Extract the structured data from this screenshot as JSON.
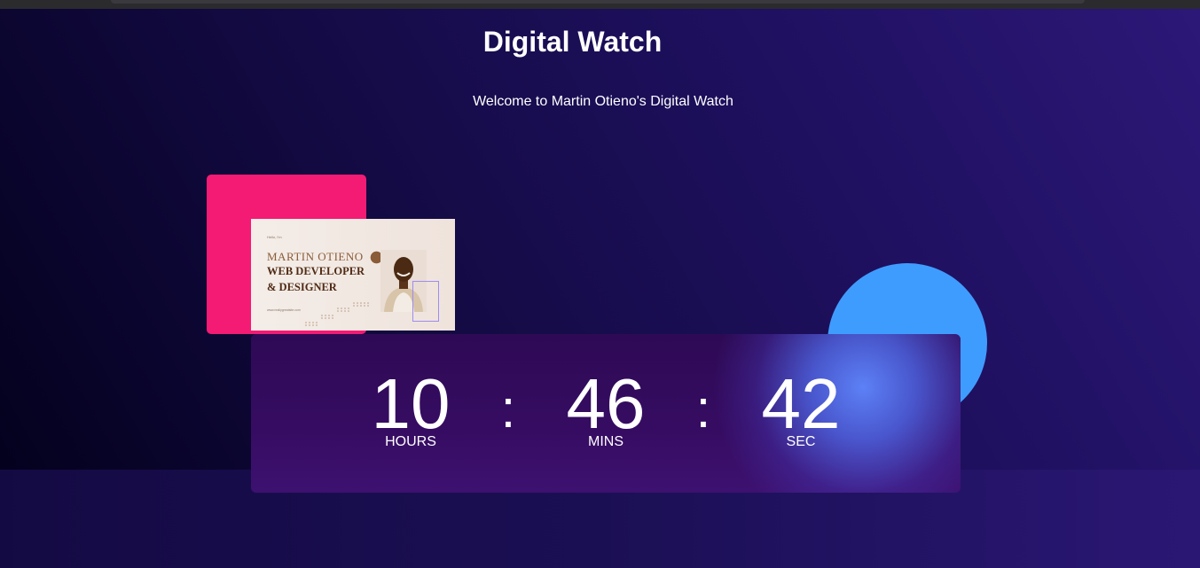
{
  "page": {
    "title": "Digital Watch",
    "subtitle": "Welcome to Martin Otieno's Digital Watch"
  },
  "banner": {
    "small_text": "Hello, I'm",
    "name": "MARTIN OTIENO",
    "role_line1": "WEB DEVELOPER",
    "role_line2": "& DESIGNER",
    "url": "www.reallygreatsite.com"
  },
  "clock": {
    "hours": "10",
    "minutes": "46",
    "seconds": "42",
    "separator": ":",
    "hours_label": "HOURS",
    "minutes_label": "MINS",
    "seconds_label": "SEC"
  },
  "colors": {
    "pink_square": "#f31b74",
    "blue_circle": "#3f9cff",
    "background_dark": "#02001a",
    "background_purple": "#2c1878"
  }
}
